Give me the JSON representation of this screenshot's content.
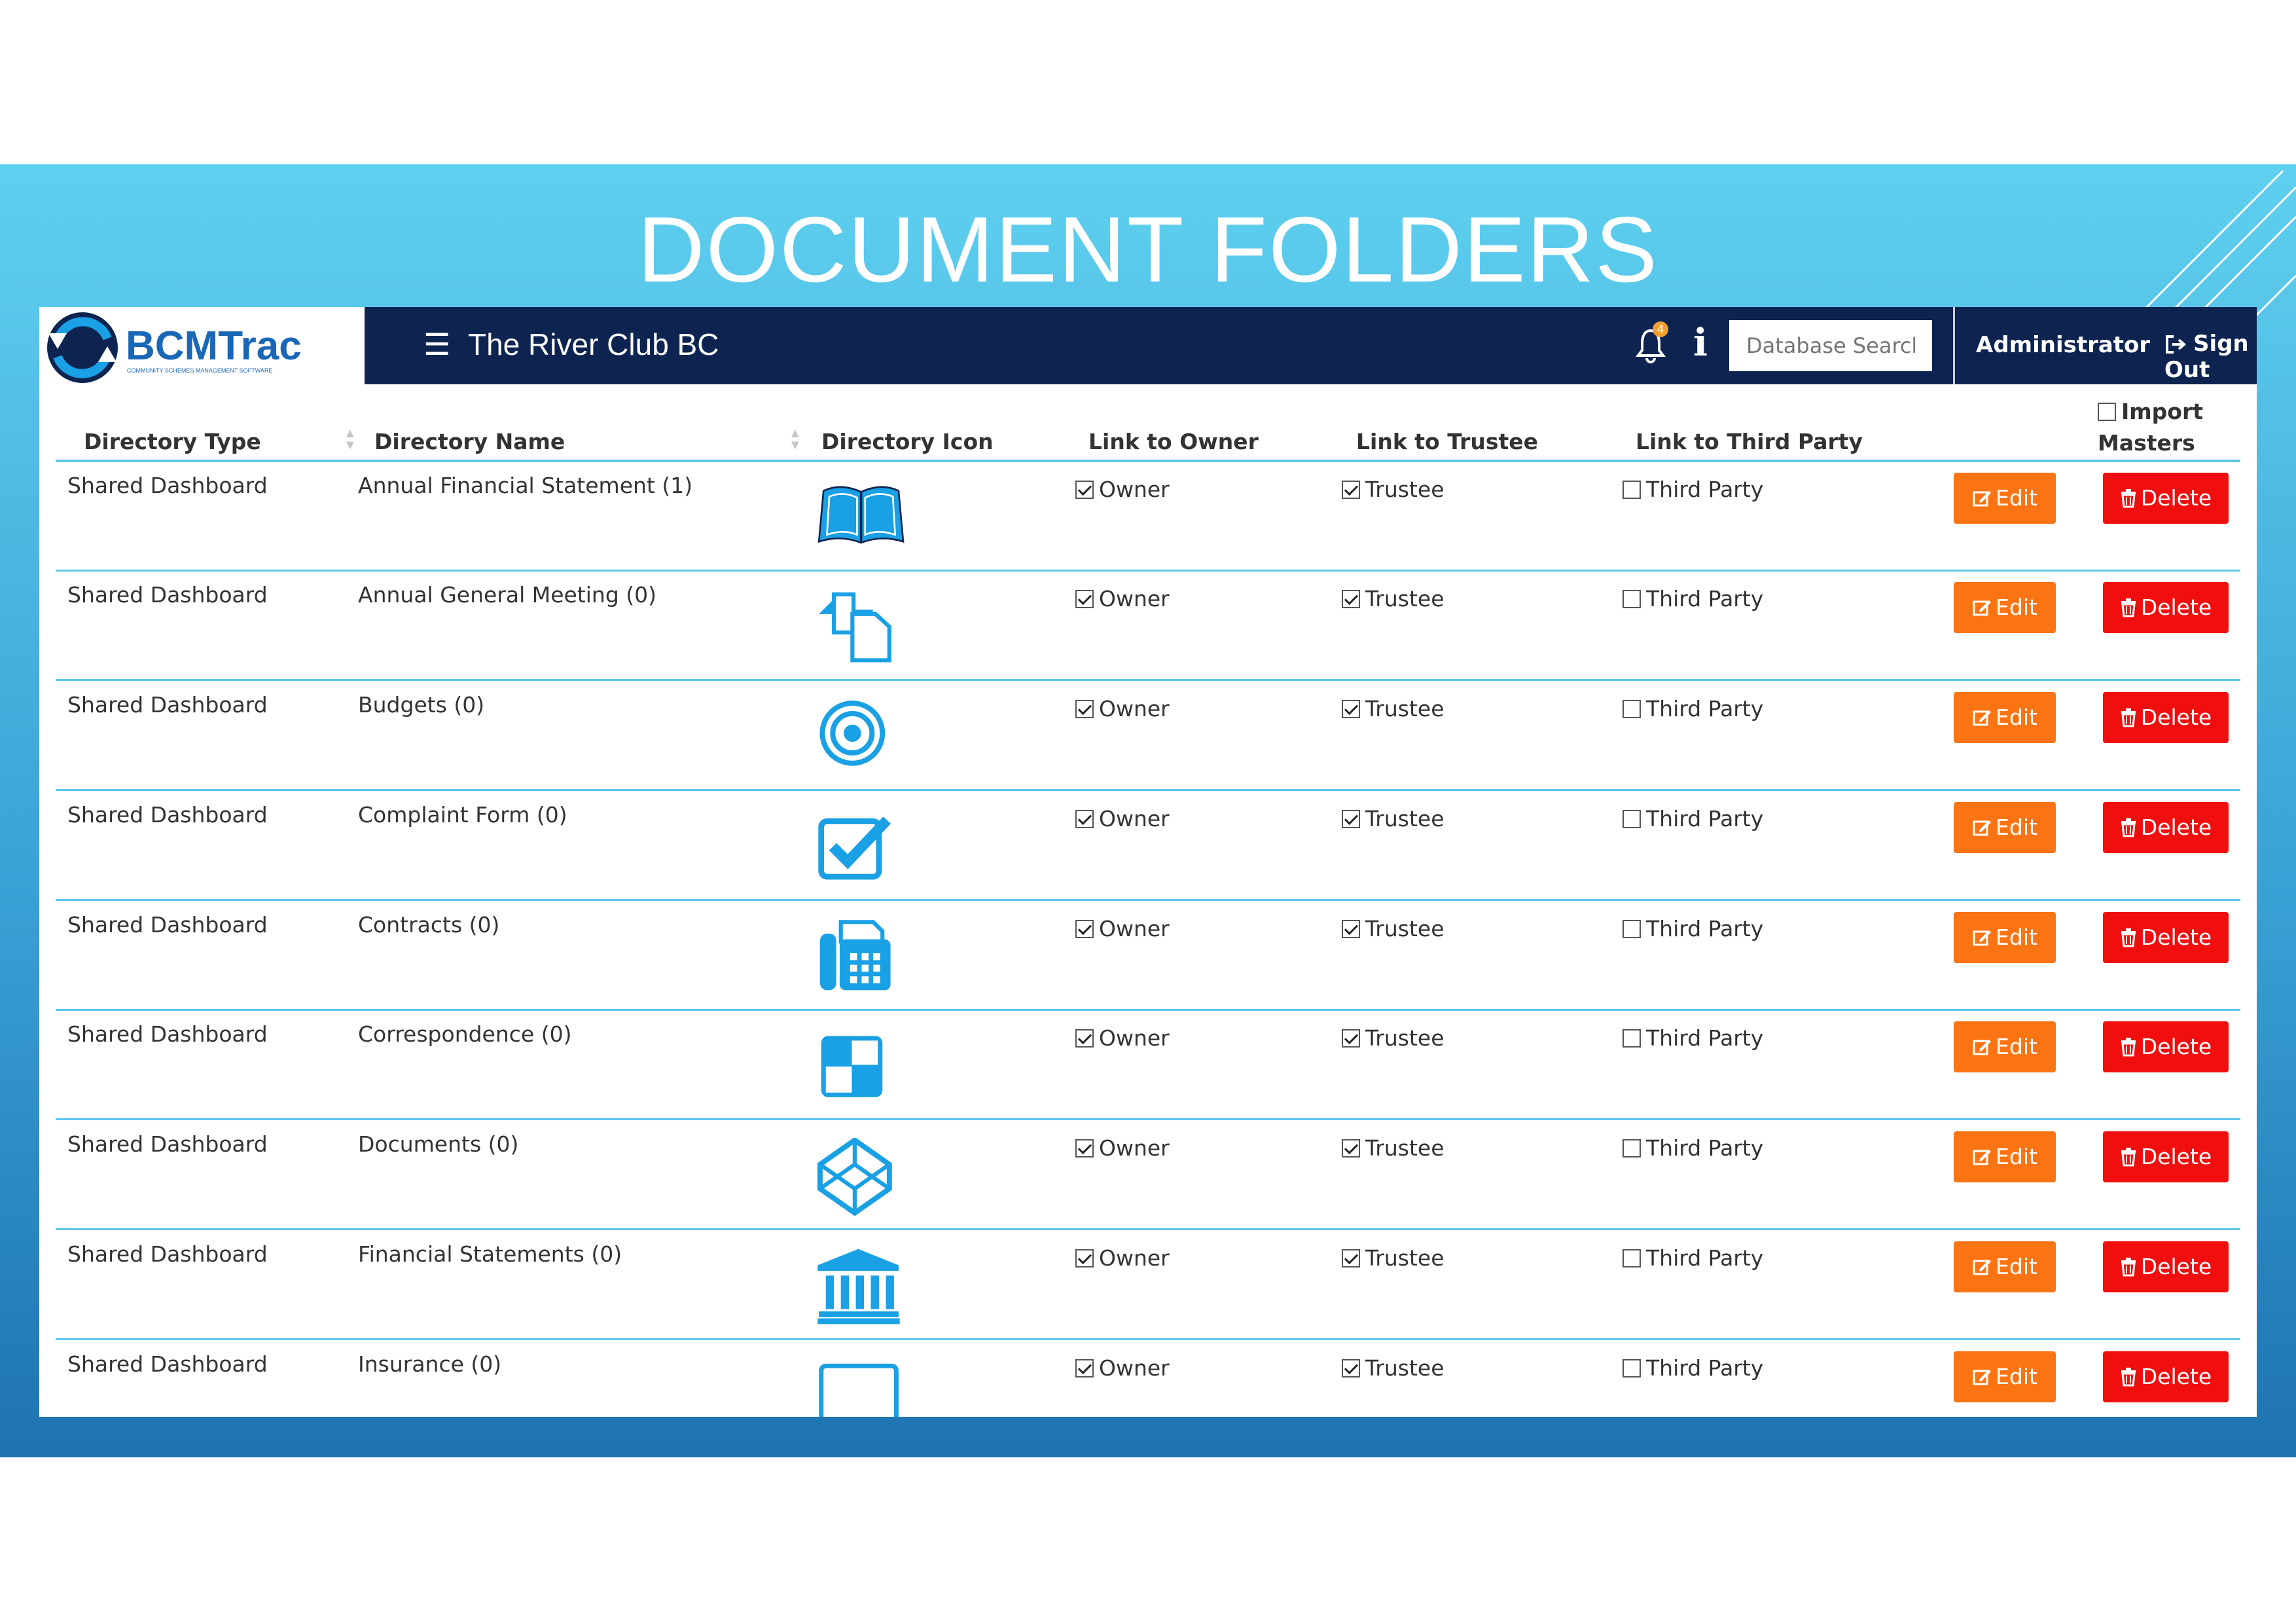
{
  "slide": {
    "title": "DOCUMENT FOLDERS"
  },
  "brand": {
    "logo_text": "BCMTrac",
    "logo_tagline": "COMMUNITY SCHEMES MANAGEMENT SOFTWARE"
  },
  "header": {
    "club_name": "The River Club BC",
    "notification_count": "4",
    "search_placeholder": "Database Search",
    "user_label": "Administrator",
    "signout_label": "Sign Out"
  },
  "table": {
    "columns": {
      "type": "Directory Type",
      "name": "Directory Name",
      "icon": "Directory Icon",
      "owner": "Link to Owner",
      "trustee": "Link to Trustee",
      "third": "Link to Third Party",
      "import": "Import Masters"
    },
    "import_checked": false,
    "rows": [
      {
        "type": "Shared Dashboard",
        "name": "Annual Financial Statement (1)",
        "icon": "open-book-icon",
        "owner": "Owner",
        "owner_checked": true,
        "trustee": "Trustee",
        "trustee_checked": true,
        "third": "Third Party",
        "third_checked": false,
        "edit": "Edit",
        "delete": "Delete"
      },
      {
        "type": "Shared Dashboard",
        "name": "Annual General Meeting (0)",
        "icon": "copy-files-icon",
        "owner": "Owner",
        "owner_checked": true,
        "trustee": "Trustee",
        "trustee_checked": true,
        "third": "Third Party",
        "third_checked": false,
        "edit": "Edit",
        "delete": "Delete"
      },
      {
        "type": "Shared Dashboard",
        "name": "Budgets (0)",
        "icon": "target-icon",
        "owner": "Owner",
        "owner_checked": true,
        "trustee": "Trustee",
        "trustee_checked": true,
        "third": "Third Party",
        "third_checked": false,
        "edit": "Edit",
        "delete": "Delete"
      },
      {
        "type": "Shared Dashboard",
        "name": "Complaint Form (0)",
        "icon": "checked-box-icon",
        "owner": "Owner",
        "owner_checked": true,
        "trustee": "Trustee",
        "trustee_checked": true,
        "third": "Third Party",
        "third_checked": false,
        "edit": "Edit",
        "delete": "Delete"
      },
      {
        "type": "Shared Dashboard",
        "name": "Contracts (0)",
        "icon": "fax-icon",
        "owner": "Owner",
        "owner_checked": true,
        "trustee": "Trustee",
        "trustee_checked": true,
        "third": "Third Party",
        "third_checked": false,
        "edit": "Edit",
        "delete": "Delete"
      },
      {
        "type": "Shared Dashboard",
        "name": "Correspondence (0)",
        "icon": "quadrant-square-icon",
        "owner": "Owner",
        "owner_checked": true,
        "trustee": "Trustee",
        "trustee_checked": true,
        "third": "Third Party",
        "third_checked": false,
        "edit": "Edit",
        "delete": "Delete"
      },
      {
        "type": "Shared Dashboard",
        "name": "Documents (0)",
        "icon": "cube-icon",
        "owner": "Owner",
        "owner_checked": true,
        "trustee": "Trustee",
        "trustee_checked": true,
        "third": "Third Party",
        "third_checked": false,
        "edit": "Edit",
        "delete": "Delete"
      },
      {
        "type": "Shared Dashboard",
        "name": "Financial Statements (0)",
        "icon": "bank-icon",
        "owner": "Owner",
        "owner_checked": true,
        "trustee": "Trustee",
        "trustee_checked": true,
        "third": "Third Party",
        "third_checked": false,
        "edit": "Edit",
        "delete": "Delete"
      },
      {
        "type": "Shared Dashboard",
        "name": "Insurance (0)",
        "icon": "window-icon",
        "owner": "Owner",
        "owner_checked": true,
        "trustee": "Trustee",
        "trustee_checked": true,
        "third": "Third Party",
        "third_checked": false,
        "edit": "Edit",
        "delete": "Delete"
      }
    ]
  },
  "colors": {
    "navbar": "#0e2450",
    "accent_blue": "#1aa0e4",
    "edit_button": "#fb7414",
    "delete_button": "#f10e0e",
    "row_divider": "#5ec5ea"
  }
}
